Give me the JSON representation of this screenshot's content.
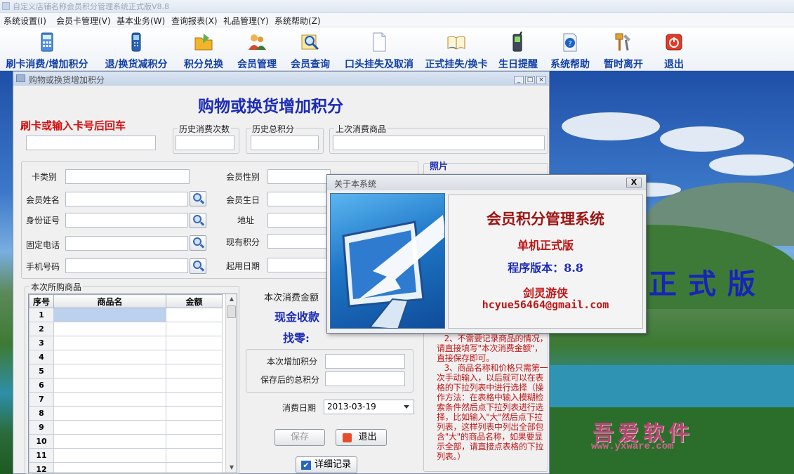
{
  "window": {
    "title": "自定义店铺名称会员积分管理系统正式版V8.8"
  },
  "menu": [
    "系统设置(I)",
    "会员卡管理(V)",
    "基本业务(W)",
    "查询报表(X)",
    "礼品管理(Y)",
    "系统帮助(Z)"
  ],
  "toolbar": [
    {
      "label": "刷卡消费/增加积分",
      "icon": "calculator-icon"
    },
    {
      "label": "退/换货减积分",
      "icon": "phone-icon"
    },
    {
      "label": "积分兑换",
      "icon": "folder-icon"
    },
    {
      "label": "会员管理",
      "icon": "users-icon"
    },
    {
      "label": "会员查询",
      "icon": "search-icon"
    },
    {
      "label": "口头挂失及取消",
      "icon": "document-icon"
    },
    {
      "label": "正式挂失/换卡",
      "icon": "book-icon"
    },
    {
      "label": "生日提醒",
      "icon": "mobile-icon"
    },
    {
      "label": "系统帮助",
      "icon": "help-icon"
    },
    {
      "label": "暂时离开",
      "icon": "tools-icon"
    },
    {
      "label": "退出",
      "icon": "exit-icon"
    }
  ],
  "form": {
    "title": "购物或换货增加积分",
    "heading": "购物或换货增加积分",
    "swipe_label": "刷卡或输入卡号后回车",
    "history_count_label": "历史消费次数",
    "history_points_label": "历史总积分",
    "last_goods_label": "上次消费商品",
    "photo_label": "照片",
    "card_type_label": "卡类别",
    "member_name_label": "会员姓名",
    "id_label": "身份证号",
    "phone_label": "固定电话",
    "mobile_label": "手机号码",
    "gender_label": "会员性别",
    "birthday_label": "会员生日",
    "address_label": "地址",
    "points_label": "现有积分",
    "start_date_label": "起用日期",
    "goods_group_label": "本次所购商品",
    "grid_headers": [
      "序号",
      "商品名",
      "金额"
    ],
    "grid_rows": [
      "1",
      "2",
      "3",
      "4",
      "5",
      "6",
      "7",
      "8",
      "9",
      "10",
      "11",
      "12"
    ],
    "amount_label": "本次消费金额",
    "cash_label": "现金收款",
    "change_label": "找零:",
    "add_points_label": "本次增加积分",
    "total_points_label": "保存后的总积分",
    "date_label": "消费日期",
    "date_value": "2013-03-19",
    "save_label": "保存",
    "exit_label": "退出",
    "detail_label": "详细记录",
    "notes": "   2、不需要记录商品的情况，请直接填写\"本次消费金额\"，直接保存即可。\n   3、商品名称和价格只需第一次手动输入，以后就可以在表格的下拉列表中进行选择（操作方法：在表格中输入模糊检索条件然后点下拉列表进行选择，比如输入\"大\"然后点下拉列表，这样列表中列出全部包含\"大\"的商品名称，如果要显示全部，请直接点表格的下拉列表。）"
  },
  "about": {
    "title": "关于本系统",
    "name": "会员积分管理系统",
    "edition": "单机正式版",
    "version": "程序版本：8.8",
    "author": "剑灵游侠",
    "email": "hcyue56464@gmail.com",
    "close": "X"
  },
  "background": {
    "text": "正式版",
    "watermark": "吾爱软件",
    "watermark_url": "www.yxware.com"
  }
}
